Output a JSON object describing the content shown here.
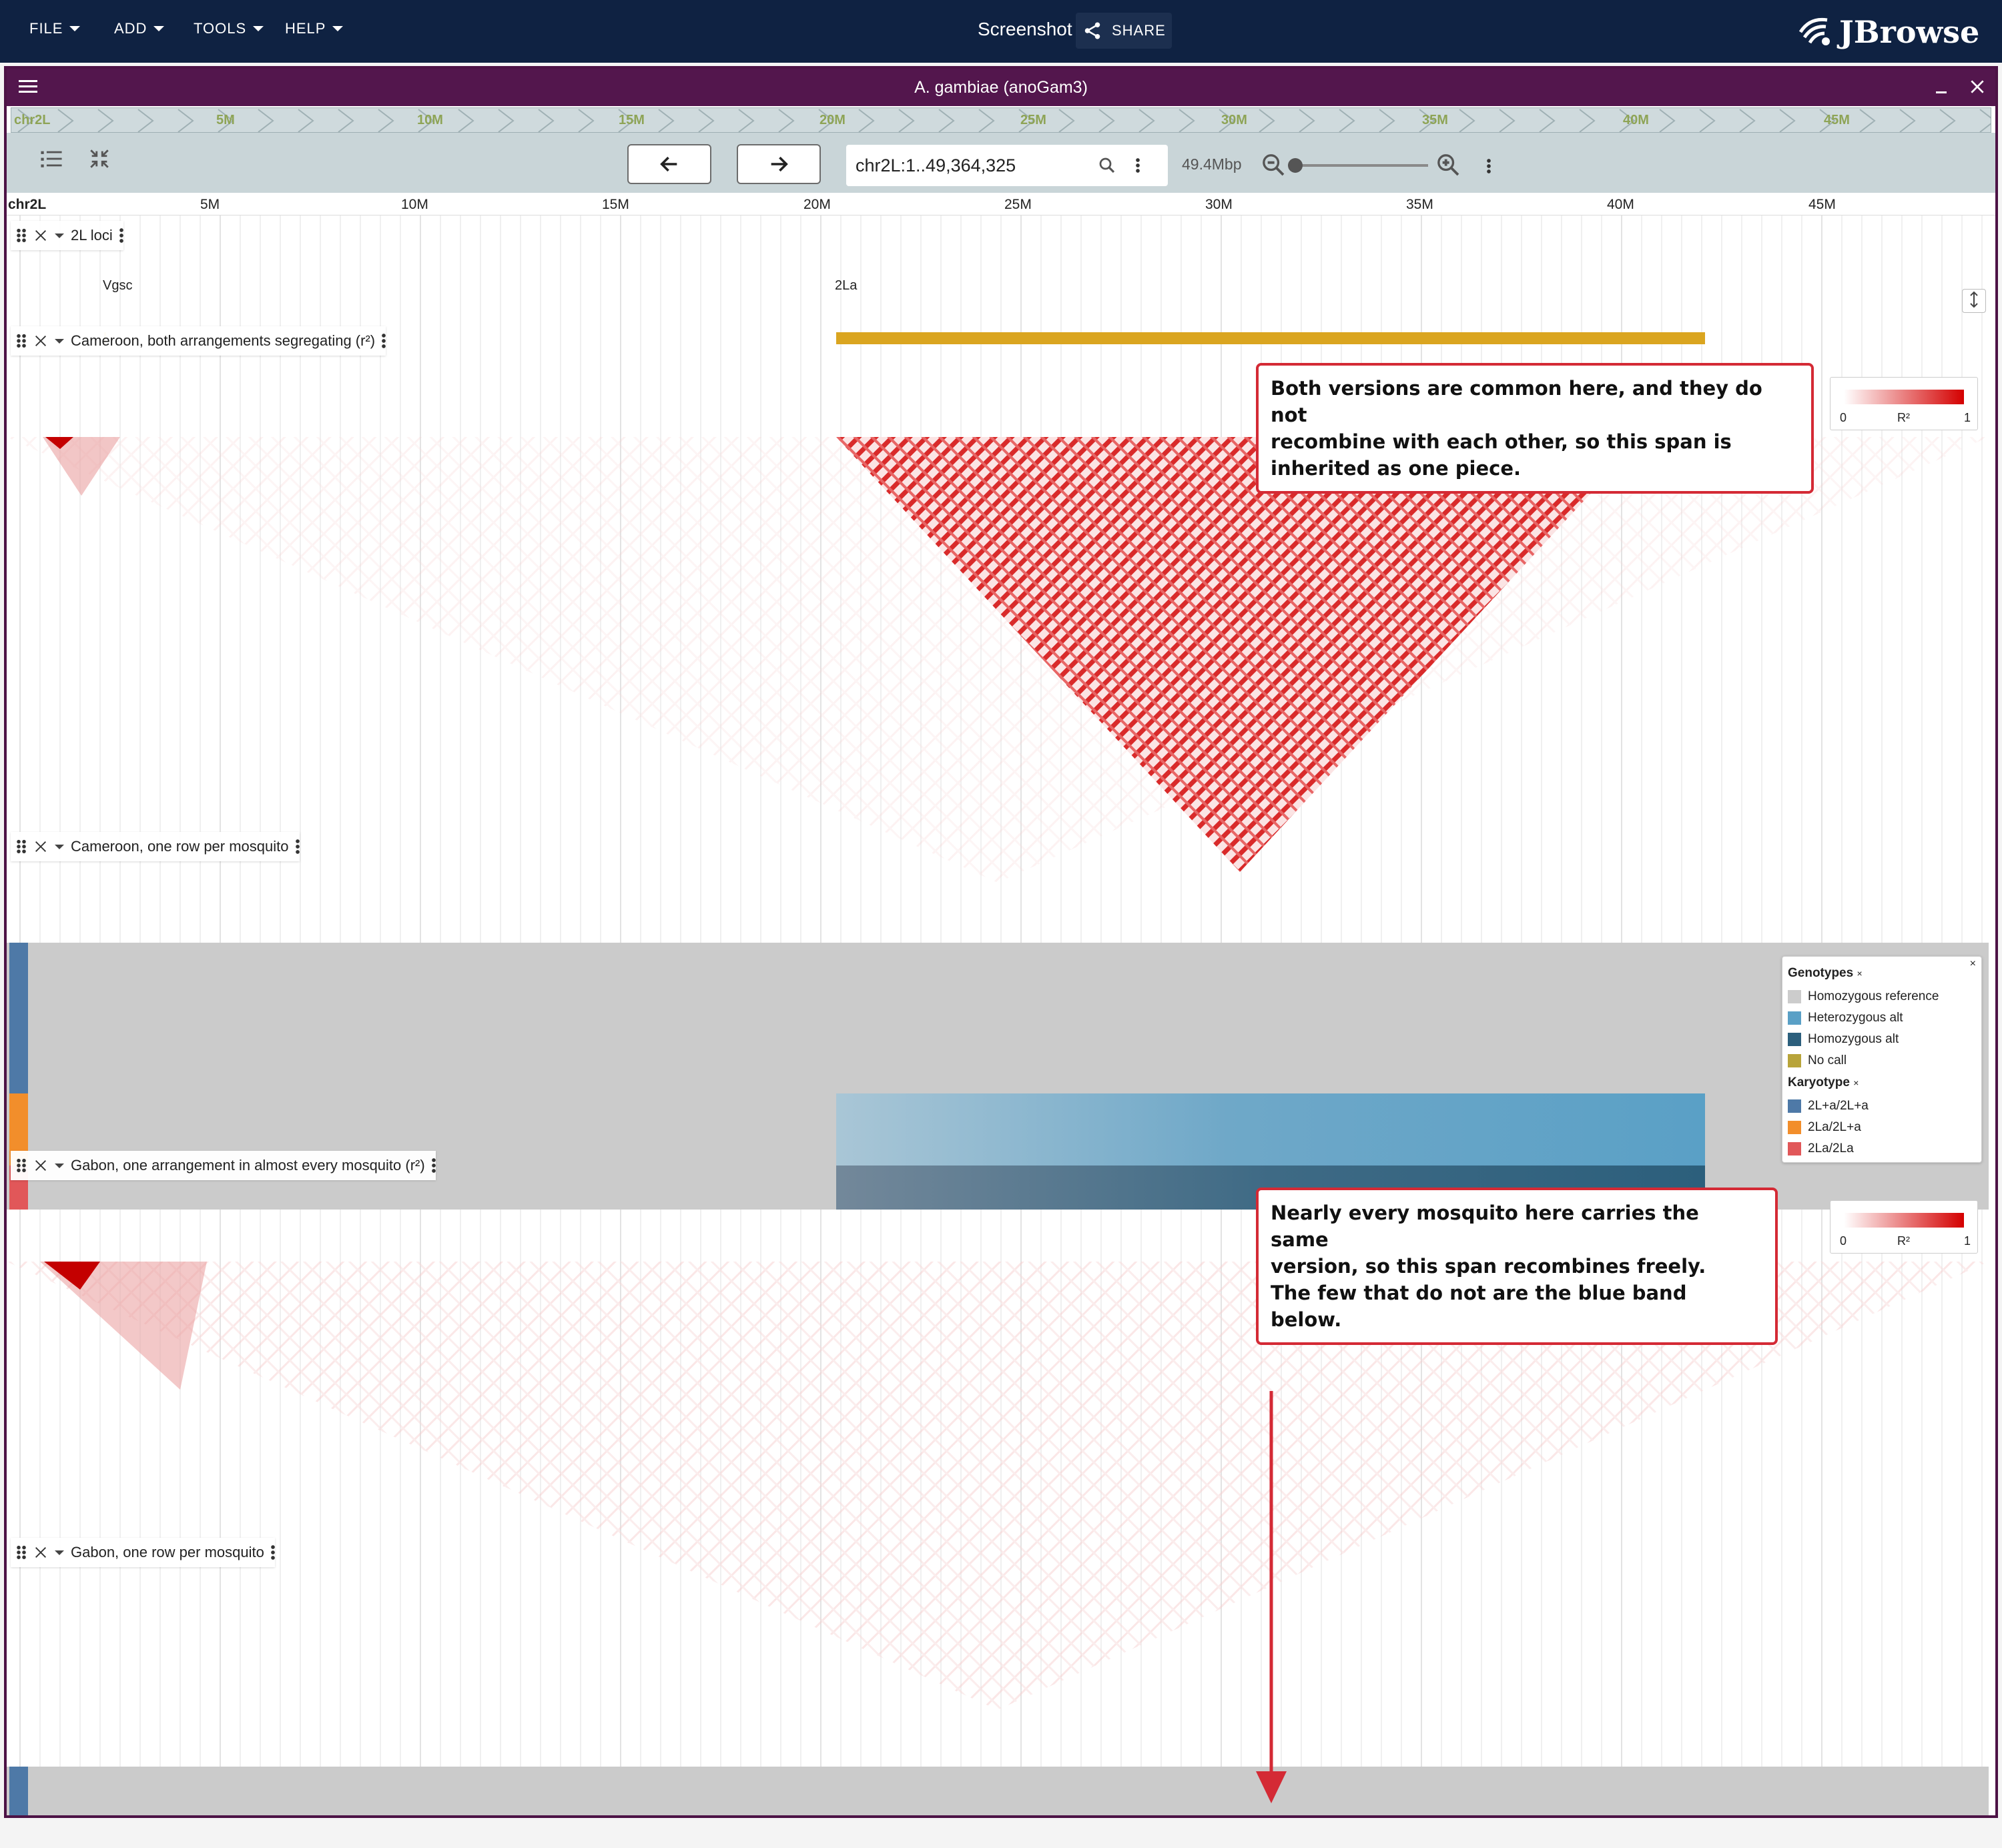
{
  "app": {
    "menus": [
      "FILE",
      "ADD",
      "TOOLS",
      "HELP"
    ],
    "screenshot_label": "Screenshot",
    "share_label": "SHARE",
    "logo_text": "JBrowse"
  },
  "view": {
    "title": "A. gambiae (anoGam3)",
    "ruler_chrom": "chr2L",
    "ruler_ticks": [
      "5M",
      "10M",
      "15M",
      "20M",
      "25M",
      "30M",
      "35M",
      "40M",
      "45M"
    ],
    "locstring": "chr2L:1..49,364,325",
    "bp_label": "49.4Mbp",
    "scale_chrom": "chr2L",
    "scale_ticks": [
      "5M",
      "10M",
      "15M",
      "20M",
      "25M",
      "30M",
      "35M",
      "40M",
      "45M"
    ]
  },
  "tracks": {
    "loci": {
      "title": "2L loci",
      "feature1": "Vgsc",
      "feature2": "2La",
      "feature_color": "#daa520"
    },
    "cam_ld": {
      "title": "Cameroon, both arrangements segregating (r²)"
    },
    "cam_geno": {
      "title": "Cameroon, one row per mosquito"
    },
    "gab_ld": {
      "title": "Gabon, one arrangement in almost every mosquito (r²)"
    },
    "gab_geno": {
      "title": "Gabon, one row per mosquito"
    }
  },
  "r2_legend": {
    "min": "0",
    "label": "R²",
    "max": "1"
  },
  "callouts": {
    "cam_line1": "Both versions are common here, and they do not",
    "cam_line2": "recombine with each other, so this span is",
    "cam_line3": "inherited as one piece.",
    "gab_line1": "Nearly every mosquito here carries the same",
    "gab_line2": "version, so this span recombines freely.",
    "gab_line3": "The few that do not are the blue band below."
  },
  "genotype_legend": {
    "genotypes_title": "Genotypes",
    "genotypes": [
      {
        "label": "Homozygous reference",
        "color": "#cccccc"
      },
      {
        "label": "Heterozygous alt",
        "color": "#5aa0c6"
      },
      {
        "label": "Homozygous alt",
        "color": "#2c5f7c"
      },
      {
        "label": "No call",
        "color": "#b8a43a"
      }
    ],
    "karyotype_title": "Karyotype",
    "karyotypes": [
      {
        "label": "2L+a/2L+a",
        "color": "#4e79a7"
      },
      {
        "label": "2La/2L+a",
        "color": "#f28e2b"
      },
      {
        "label": "2La/2La",
        "color": "#e15759"
      }
    ]
  }
}
